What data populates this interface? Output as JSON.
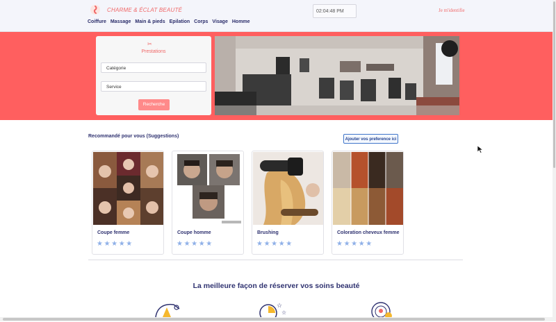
{
  "header": {
    "brand": "CHARME & ÉCLAT BEAUTÉ",
    "clock": "02:04:48 PM",
    "login": "Je m'identifie",
    "nav": [
      "Coiffure",
      "Massage",
      "Main & pieds",
      "Epilation",
      "Corps",
      "Visage",
      "Homme"
    ]
  },
  "search": {
    "icon": "scissors-icon",
    "title": "Prestations",
    "category_placeholder": "Catégorie",
    "service_placeholder": "Service",
    "button": "Recherche"
  },
  "suggestions": {
    "title": "Recommandé pour vous (Suggestions)",
    "pref_button": "Ajouter vos preference ici",
    "cards": [
      {
        "name": "Coupe femme",
        "rating": 5
      },
      {
        "name": "Coupe homme",
        "rating": 5
      },
      {
        "name": "Brushing",
        "rating": 5
      },
      {
        "name": "Coloration cheveux femme",
        "rating": 5
      }
    ],
    "stars": "★★★★★"
  },
  "features": {
    "headline": "La meilleure façon de réserver vos soins beauté",
    "icons": [
      "gift-icon",
      "clock-star-icon",
      "location-pin-icon"
    ]
  },
  "colors": {
    "accent": "#ff5f5f",
    "navy": "#2f3270",
    "star": "#8fb0e8"
  }
}
